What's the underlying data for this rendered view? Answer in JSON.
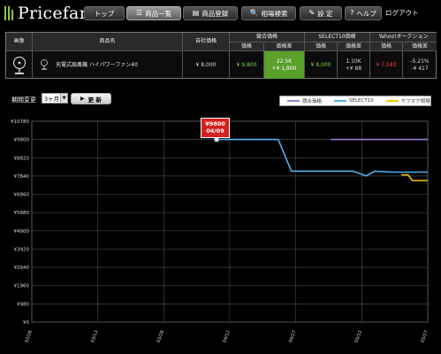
{
  "app": {
    "logo": "Pricefan",
    "logout": "ログアウト"
  },
  "nav": [
    {
      "label": "トップ",
      "icon": ""
    },
    {
      "label": "商品一覧",
      "icon": "☰"
    },
    {
      "label": "商品登録",
      "icon": "▤"
    },
    {
      "label": "相場検索",
      "icon": "🔍"
    },
    {
      "label": "設 定",
      "icon": "✎"
    },
    {
      "label": "ヘルプ",
      "icon": "?"
    }
  ],
  "table": {
    "headers": {
      "image": "画像",
      "name": "商品名",
      "own_price": "自社価格",
      "competitor": "競合価格",
      "select10": "SELECT10価格",
      "yahoo": "Yahoo!オークション",
      "price": "価格",
      "diff": "価格差"
    },
    "row": {
      "name": "充電式扇風機 ハイパワーファン40",
      "own_price": "¥ 8,000",
      "comp_price": "¥ 9,800",
      "comp_diff_pct": "22.5K",
      "comp_diff_amt": "+¥ 1,800",
      "sel_price": "¥ 8,000",
      "sel_diff_pct": "1.10K",
      "sel_diff_amt": "+¥ 88",
      "yah_price": "¥ 7,583",
      "yah_diff_pct": "-5.21%",
      "yah_diff_amt": "-¥ 417"
    }
  },
  "period": {
    "label": "期間変更",
    "selected": "3ヶ月",
    "update": "更 新"
  },
  "tooltip": {
    "price": "¥9800",
    "date": "04/09"
  },
  "colors": {
    "competitor": "#9b7fd1",
    "select10": "#4fb2ee",
    "yahoo": "#f2c500",
    "accent": "#5aa02c"
  },
  "chart_data": {
    "type": "line",
    "y_ticks": [
      "¥10780",
      "¥9800",
      "¥8820",
      "¥7840",
      "¥6860",
      "¥5880",
      "¥4900",
      "¥3920",
      "¥2940",
      "¥1960",
      "¥980",
      "¥0"
    ],
    "x_ticks": [
      "02/26",
      "03/13",
      "03/28",
      "04/12",
      "04/27",
      "05/12",
      "05/27"
    ],
    "ylim": [
      0,
      10780
    ],
    "xlim": [
      0,
      90
    ],
    "grid": true,
    "legend_position": "top-right",
    "series": [
      {
        "name": "競合価格",
        "color": "#9b7fd1",
        "points": [
          [
            68,
            9800
          ],
          [
            90,
            9800
          ]
        ]
      },
      {
        "name": "SELECT10",
        "color": "#4fb2ee",
        "points": [
          [
            42,
            9800
          ],
          [
            56,
            9800
          ],
          [
            59,
            8100
          ],
          [
            73,
            8100
          ],
          [
            76,
            7850
          ],
          [
            78,
            8100
          ],
          [
            82,
            8050
          ],
          [
            90,
            8050
          ]
        ]
      },
      {
        "name": "ヤフオク相場",
        "color": "#f2c500",
        "points": [
          [
            84,
            7900
          ],
          [
            85.5,
            7900
          ],
          [
            86.5,
            7600
          ],
          [
            90,
            7600
          ]
        ]
      }
    ]
  }
}
